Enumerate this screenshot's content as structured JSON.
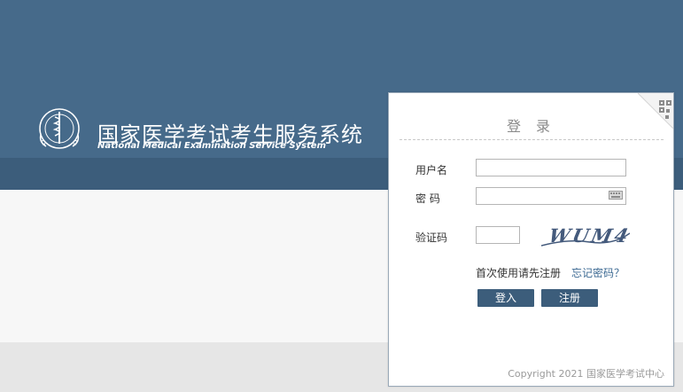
{
  "header": {
    "title_cn": "国家医学考试考生服务系统",
    "title_en": "National Medical Examination Service System"
  },
  "login": {
    "title": "登 录",
    "username_label": "用户名",
    "username_value": "",
    "password_label": "密 码",
    "password_value": "",
    "captcha_label": "验证码",
    "captcha_value": "",
    "captcha_text": "WUM4",
    "first_use_hint": "首次使用请先注册",
    "forgot_password": "忘记密码？",
    "login_button": "登入",
    "register_button": "注册",
    "copyright": "Copyright 2021 国家医学考试中心"
  },
  "colors": {
    "header_bg": "#466a8a",
    "band_bg": "#3c5d7b",
    "button_bg": "#3c5d7b",
    "link": "#3d6a93"
  },
  "icons": {
    "logo": "medical-emblem-icon",
    "qr_corner": "qr-code-icon",
    "keyboard": "soft-keyboard-icon"
  }
}
